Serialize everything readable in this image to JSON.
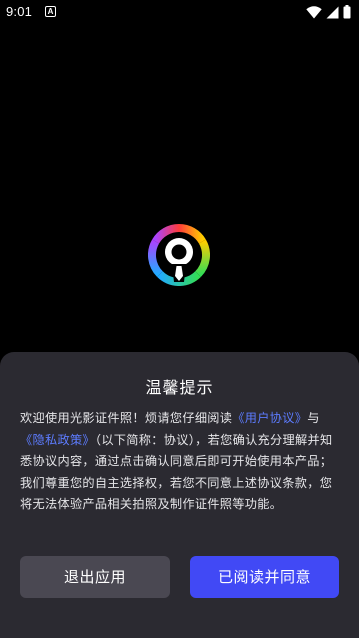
{
  "status_bar": {
    "time": "9:01",
    "notification_icon": "A",
    "icons": [
      "wifi-icon",
      "cellular-signal-icon",
      "battery-icon"
    ]
  },
  "logo": {
    "icon": "app-logo-icon",
    "colors": [
      "#ff3b3b",
      "#ffcc00",
      "#33dd55",
      "#22aaff",
      "#aa44ff"
    ]
  },
  "dialog": {
    "title": "温馨提示",
    "body": {
      "intro": "欢迎使用光影证件照！烦请您仔细阅读",
      "user_agreement_link": "《用户协议》",
      "and": "与",
      "privacy_policy_link": "《隐私政策》",
      "rest": "（以下简称：协议），若您确认充分理解并知悉协议内容，通过点击确认同意后即可开始使用本产品；我们尊重您的自主选择权，若您不同意上述协议条款，您将无法体验产品相关拍照及制作证件照等功能。"
    },
    "exit_button": "退出应用",
    "agree_button": "已阅读并同意"
  },
  "colors": {
    "background": "#000000",
    "dialog_background": "#2b2a31",
    "link": "#5d7cff",
    "primary_button": "#4149f5",
    "secondary_button": "#4a4852"
  }
}
